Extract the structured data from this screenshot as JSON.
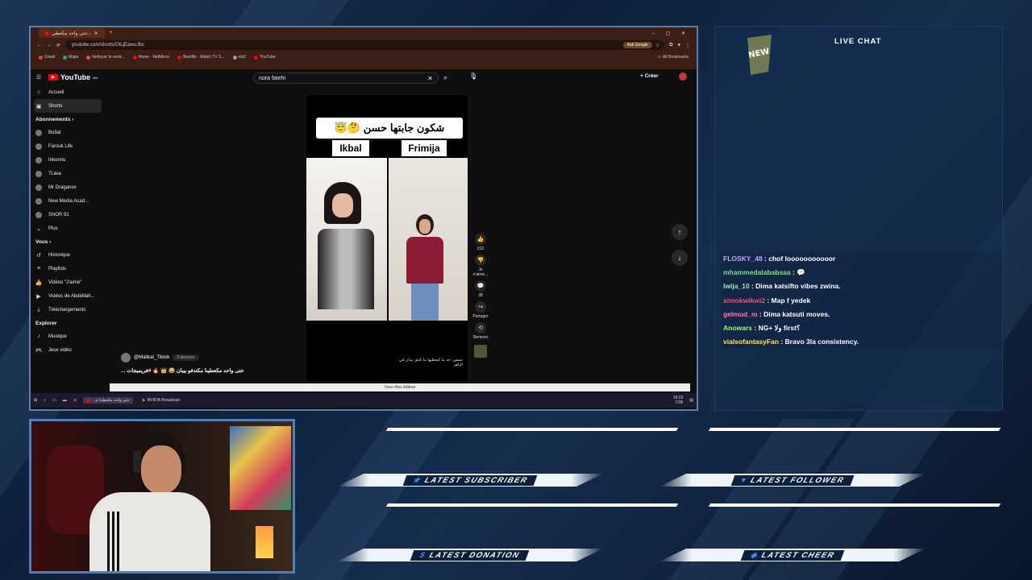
{
  "browser": {
    "tab_title": "حتى واحد مكعطي...",
    "url": "youtube.com/shorts/OtLjEawu.fbs",
    "ask_google": "Ask Google",
    "bookmarks": [
      "Gmail",
      "Maps",
      "Nettoyer le envir...",
      "Home - NetMirror",
      "Bnetflix - Watch TV S...",
      "nib2",
      "YouTube"
    ],
    "all_bookmarks": "All Bookmarks"
  },
  "youtube": {
    "logo": "YouTube",
    "region": "MA",
    "search_value": "nora fatehi",
    "create": "Créer",
    "nav": [
      {
        "label": "Accueil",
        "icon": "home-icon"
      },
      {
        "label": "Shorts",
        "icon": "shorts-icon"
      }
    ],
    "subs_header": "Abonnements",
    "subscriptions": [
      "Bo9al",
      "Farouk Life",
      "Inkonnu",
      "7Liwa",
      "Mr Draganov",
      "New Media Acad...",
      "SNOR 91"
    ],
    "more": "Plus",
    "you_header": "Vous",
    "you_items": [
      {
        "label": "Historique",
        "icon": "history-icon"
      },
      {
        "label": "Playlists",
        "icon": "playlist-icon"
      },
      {
        "label": "Vidéos \"J'aime\"",
        "icon": "like-icon"
      },
      {
        "label": "Vidéos de Abdelilah...",
        "icon": "video-icon"
      },
      {
        "label": "Téléchargements",
        "icon": "download-icon"
      }
    ],
    "explore_header": "Explorer",
    "explore_items": [
      {
        "label": "Musique",
        "icon": "music-icon"
      },
      {
        "label": "Jeux vidéo",
        "icon": "game-icon"
      }
    ],
    "video": {
      "title_text": "شكون جابتها حسن 🤔😇",
      "left_name": "Ikbal",
      "right_name": "Frimija",
      "bottom_text": "سيفي: حد ما كيعطيها ما كتنق بيبان في الباهر"
    },
    "actions": {
      "likes": "212",
      "dislike": "Je n'aime...",
      "comments": "38",
      "share": "Partager",
      "remix": "Remixer"
    },
    "channel": "@Malikat_Tiktok",
    "subscribe": "S'abonner",
    "caption": "حتى واحد مكعطينا مكتدفو بيبان 😂 👑 🔥 #فريميجات ...",
    "editor_notice": "Vous êtes éditeur"
  },
  "taskbar": {
    "items": [
      "حتى واحد مكعطينا م...",
      "NVIDIA Broadcast"
    ],
    "time": "19:23",
    "date": "7/06"
  },
  "chat": {
    "title": "LIVE CHAT",
    "messages": [
      {
        "user": "FLOSKY_48",
        "text": "chof looooooooooor",
        "color": "#c9a0ff"
      },
      {
        "user": "mhammedalababsaa",
        "text": "💬",
        "color": "#7de08a"
      },
      {
        "user": "lwija_10",
        "text": "Dima katsifto vibes zwina.",
        "color": "#9ee6c1"
      },
      {
        "user": "simokwikwi2",
        "text": "Map f yedek",
        "color": "#ff4d6d"
      },
      {
        "user": "gelmud_m",
        "text": "Dima katsuti moves.",
        "color": "#ff7aa8"
      },
      {
        "user": "Anowars",
        "text": "NG+ ولا first؟",
        "color": "#9dff5a"
      },
      {
        "user": "vialsofantasyFan",
        "text": "Bravo 3la consistency.",
        "color": "#ffe36b"
      }
    ]
  },
  "alerts": {
    "subscriber": "LATEST SUBSCRIBER",
    "follower": "LATEST FOLLOWER",
    "donation": "LATEST DONATION",
    "cheer": "LATEST CHEER"
  }
}
